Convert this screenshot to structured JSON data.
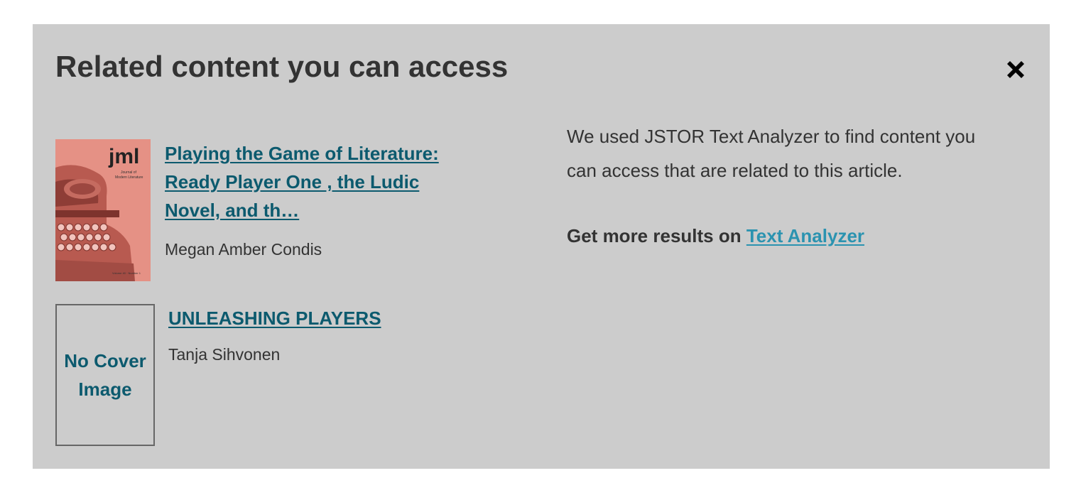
{
  "dialog": {
    "title": "Related content you can access",
    "close_icon": "close-x-icon"
  },
  "results": [
    {
      "title": "Playing the Game of Literature: Ready Player One , the Ludic Novel, and th…",
      "author": "Megan Amber Condis",
      "cover": {
        "journal_abbr": "jml",
        "journal_name": "Journal of Modern Literature",
        "color": "#e7968a"
      }
    },
    {
      "title": "UNLEASHING PLAYERS",
      "author": "Tanja Sihvonen",
      "cover": {
        "placeholder": "No Cover Image"
      }
    }
  ],
  "info": {
    "description": "We used JSTOR Text Analyzer to find content you can access that are related to this article.",
    "more_prefix": "Get more results on",
    "more_link": "Text Analyzer"
  },
  "colors": {
    "panel_bg": "#cccccc",
    "link_dark": "#0c5a6e",
    "link_light": "#2b93b0",
    "text": "#333333"
  }
}
